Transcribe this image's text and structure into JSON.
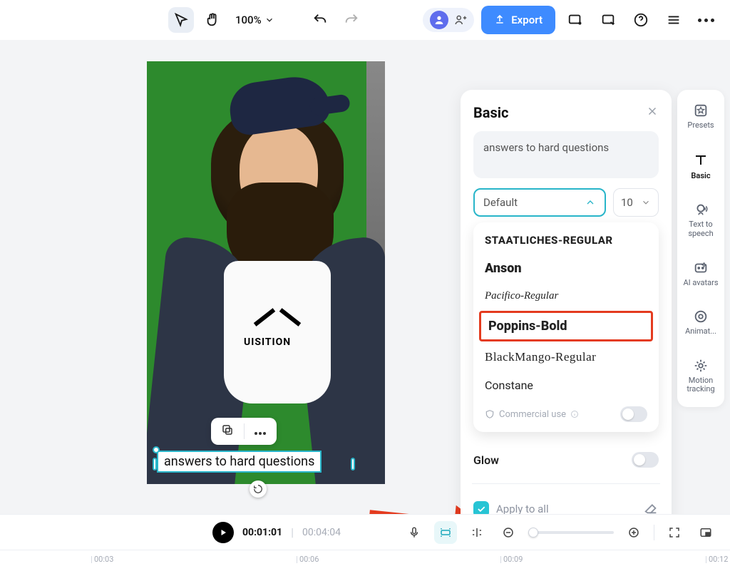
{
  "toolbar": {
    "zoom": "100%",
    "export_label": "Export"
  },
  "right_rail": {
    "items": [
      {
        "label": "Presets"
      },
      {
        "label": "Basic"
      },
      {
        "label": "Text to speech"
      },
      {
        "label": "AI avatars"
      },
      {
        "label": "Animat..."
      },
      {
        "label": "Motion tracking"
      }
    ]
  },
  "canvas": {
    "shirt_brand": "UISITION",
    "text_overlay": "answers to hard questions"
  },
  "panel": {
    "title": "Basic",
    "textarea_value": "answers to hard questions",
    "font_selected": "Default",
    "font_size": "10",
    "font_options": [
      "Staatliches-Regular",
      "Anson",
      "Pacifico-Regular",
      "Poppins-Bold",
      "BlackMango-Regular",
      "Constane"
    ],
    "commercial_label": "Commercial use",
    "glow_label": "Glow",
    "apply_all_label": "Apply to all"
  },
  "playback": {
    "current": "00:01:01",
    "duration": "00:04:04"
  },
  "ruler": {
    "ticks": [
      "00:03",
      "00:06",
      "00:09",
      "00:12"
    ]
  }
}
